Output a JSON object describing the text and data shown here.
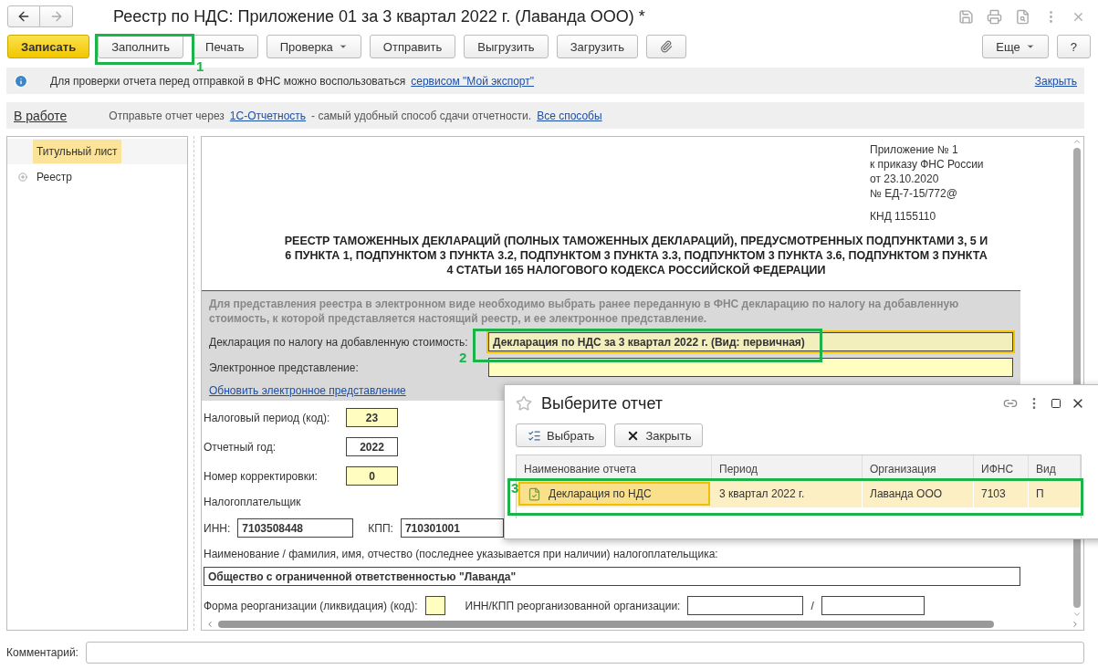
{
  "window": {
    "title": "Реестр по НДС: Приложение 01 за 3 квартал 2022 г. (Лаванда ООО) *"
  },
  "toolbar": {
    "buttons": [
      {
        "label": "Записать",
        "kind": "primary"
      },
      {
        "label": "Заполнить",
        "kind": "plain"
      },
      {
        "label": "Печать",
        "kind": "plain"
      },
      {
        "label": "Проверка",
        "kind": "menu"
      },
      {
        "label": "Отправить",
        "kind": "plain"
      },
      {
        "label": "Выгрузить",
        "kind": "plain"
      },
      {
        "label": "Загрузить",
        "kind": "plain"
      }
    ],
    "right_buttons": [
      {
        "label": "Еще",
        "kind": "menu"
      },
      {
        "label": "?",
        "kind": "plain"
      }
    ]
  },
  "info_bar": {
    "text": "Для проверки отчета перед отправкой в ФНС можно воспользоваться",
    "link": "сервисом \"Мой экспорт\"",
    "close": "Закрыть"
  },
  "status_bar": {
    "status": "В работе",
    "text_before": "Отправьте отчет через",
    "link": "1С-Отчетность",
    "text_after": "- самый удобный способ сдачи отчетности.",
    "link2": "Все способы"
  },
  "tree": [
    {
      "label": "Титульный лист",
      "selected": true
    },
    {
      "label": "Реестр",
      "selected": false,
      "expanded": false
    }
  ],
  "document": {
    "header_lines": [
      "Приложение № 1",
      "к приказу ФНС России",
      "от 23.10.2020",
      "№ ЕД-7-15/772@"
    ],
    "knd": "КНД 1155110",
    "title": "РЕЕСТР ТАМОЖЕННЫХ ДЕКЛАРАЦИЙ (ПОЛНЫХ ТАМОЖЕННЫХ ДЕКЛАРАЦИЙ), ПРЕДУСМОТРЕННЫХ ПОДПУНКТАМИ 3, 5 И 6 ПУНКТА 1, ПОДПУНКТОМ 3 ПУНКТА 3.2, ПОДПУНКТОМ 3 ПУНКТА 3.3, ПОДПУНКТОМ 3 ПУНКТА 3.6, ПОДПУНКТОМ 3 ПУНКТА 4 СТАТЬИ 165 НАЛОГОВОГО КОДЕКСА РОССИЙСКОЙ ФЕДЕРАЦИИ",
    "electronic": {
      "note": "Для представления реестра в электронном виде необходимо выбрать ранее переданную в ФНС декларацию по налогу на добавленную стоимость, к которой представляется настоящий реестр, и ее электронное представление.",
      "fields": [
        {
          "label": "Декларация по налогу на добавленную стоимость:",
          "value": "Декларация по НДС за 3 квартал 2022 г. (Вид: первичная)",
          "focused": true
        },
        {
          "label": "Электронное представление:",
          "focused": false
        }
      ],
      "link": "Обновить электронное представление"
    },
    "code_fields": [
      {
        "label": "Налоговый период (код):",
        "value": "23",
        "editable": true
      },
      {
        "label": "Отчетный год:",
        "value": "2022",
        "editable": false
      },
      {
        "label": "Номер корректировки:",
        "value": "0",
        "editable": true
      }
    ],
    "taxpayer_label": "Налогоплательщик",
    "inn": {
      "label": "ИНН:",
      "value": "7103508448"
    },
    "kpp": {
      "label": "КПП:",
      "value": "710301001"
    },
    "name_label": "Наименование / фамилия, имя, отчество (последнее указывается при наличии) налогоплательщика:",
    "name_value": "Общество с ограниченной ответственностью \"Лаванда\"",
    "reorg_label": "Форма реорганизации (ликвидация) (код):",
    "reorg_inn_label": "ИНН/КПП реорганизованной организации:",
    "reorg_sep": "/"
  },
  "comment": {
    "label": "Комментарий:"
  },
  "dialog": {
    "title": "Выберите отчет",
    "buttons": [
      {
        "label": "Выбрать",
        "kind": "select"
      },
      {
        "label": "Закрыть",
        "kind": "close"
      }
    ],
    "columns": [
      "Наименование отчета",
      "Период",
      "Организация",
      "ИФНС",
      "Вид"
    ],
    "rows": [
      {
        "cells": [
          "Декларация по НДС",
          "3 квартал 2022 г.",
          "Лаванда ООО",
          "7103",
          "П"
        ],
        "selected": true
      }
    ]
  },
  "callouts": [
    {
      "label": "1"
    },
    {
      "label": "2"
    },
    {
      "label": "3"
    }
  ]
}
